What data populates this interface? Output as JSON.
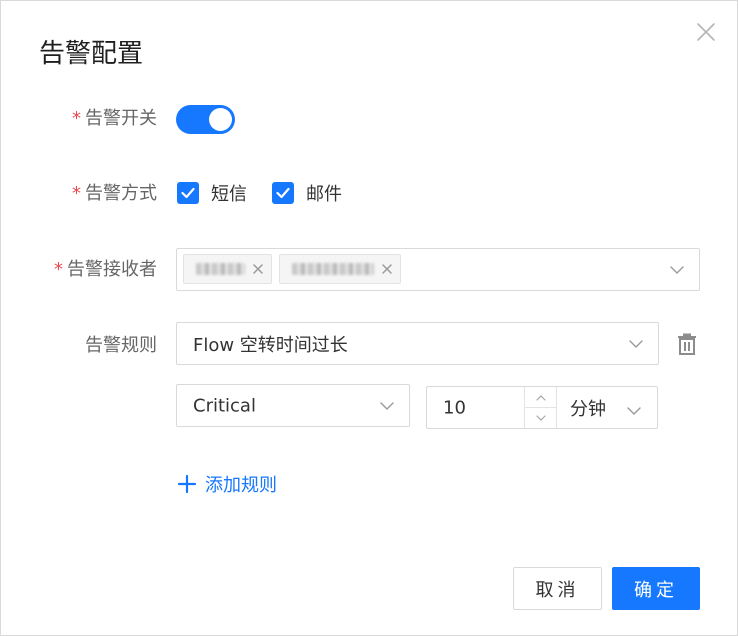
{
  "dialog": {
    "title": "告警配置",
    "close_icon": "close-icon"
  },
  "form": {
    "required_mark": "*",
    "alert_switch": {
      "label": "告警开关",
      "on": true,
      "color": "#1677ff"
    },
    "alert_method": {
      "label": "告警方式",
      "options": [
        {
          "label": "短信",
          "checked": true
        },
        {
          "label": "邮件",
          "checked": true
        }
      ]
    },
    "alert_receivers": {
      "label": "告警接收者",
      "tags_note": "two selected recipient tags with blurred names",
      "chevron_icon": "chevron-down-icon"
    },
    "alert_rules": {
      "label": "告警规则",
      "rule_type": "Flow 空转时间过长",
      "severity": "Critical",
      "duration_value": "10",
      "duration_unit": "分钟",
      "delete_icon": "trash-icon",
      "add_rule_label": "添加规则"
    }
  },
  "footer": {
    "cancel_label": "取消",
    "confirm_label": "确定"
  },
  "colors": {
    "primary": "#1677ff",
    "required": "#e5484d",
    "label": "#666666",
    "border": "#d9d9d9"
  }
}
